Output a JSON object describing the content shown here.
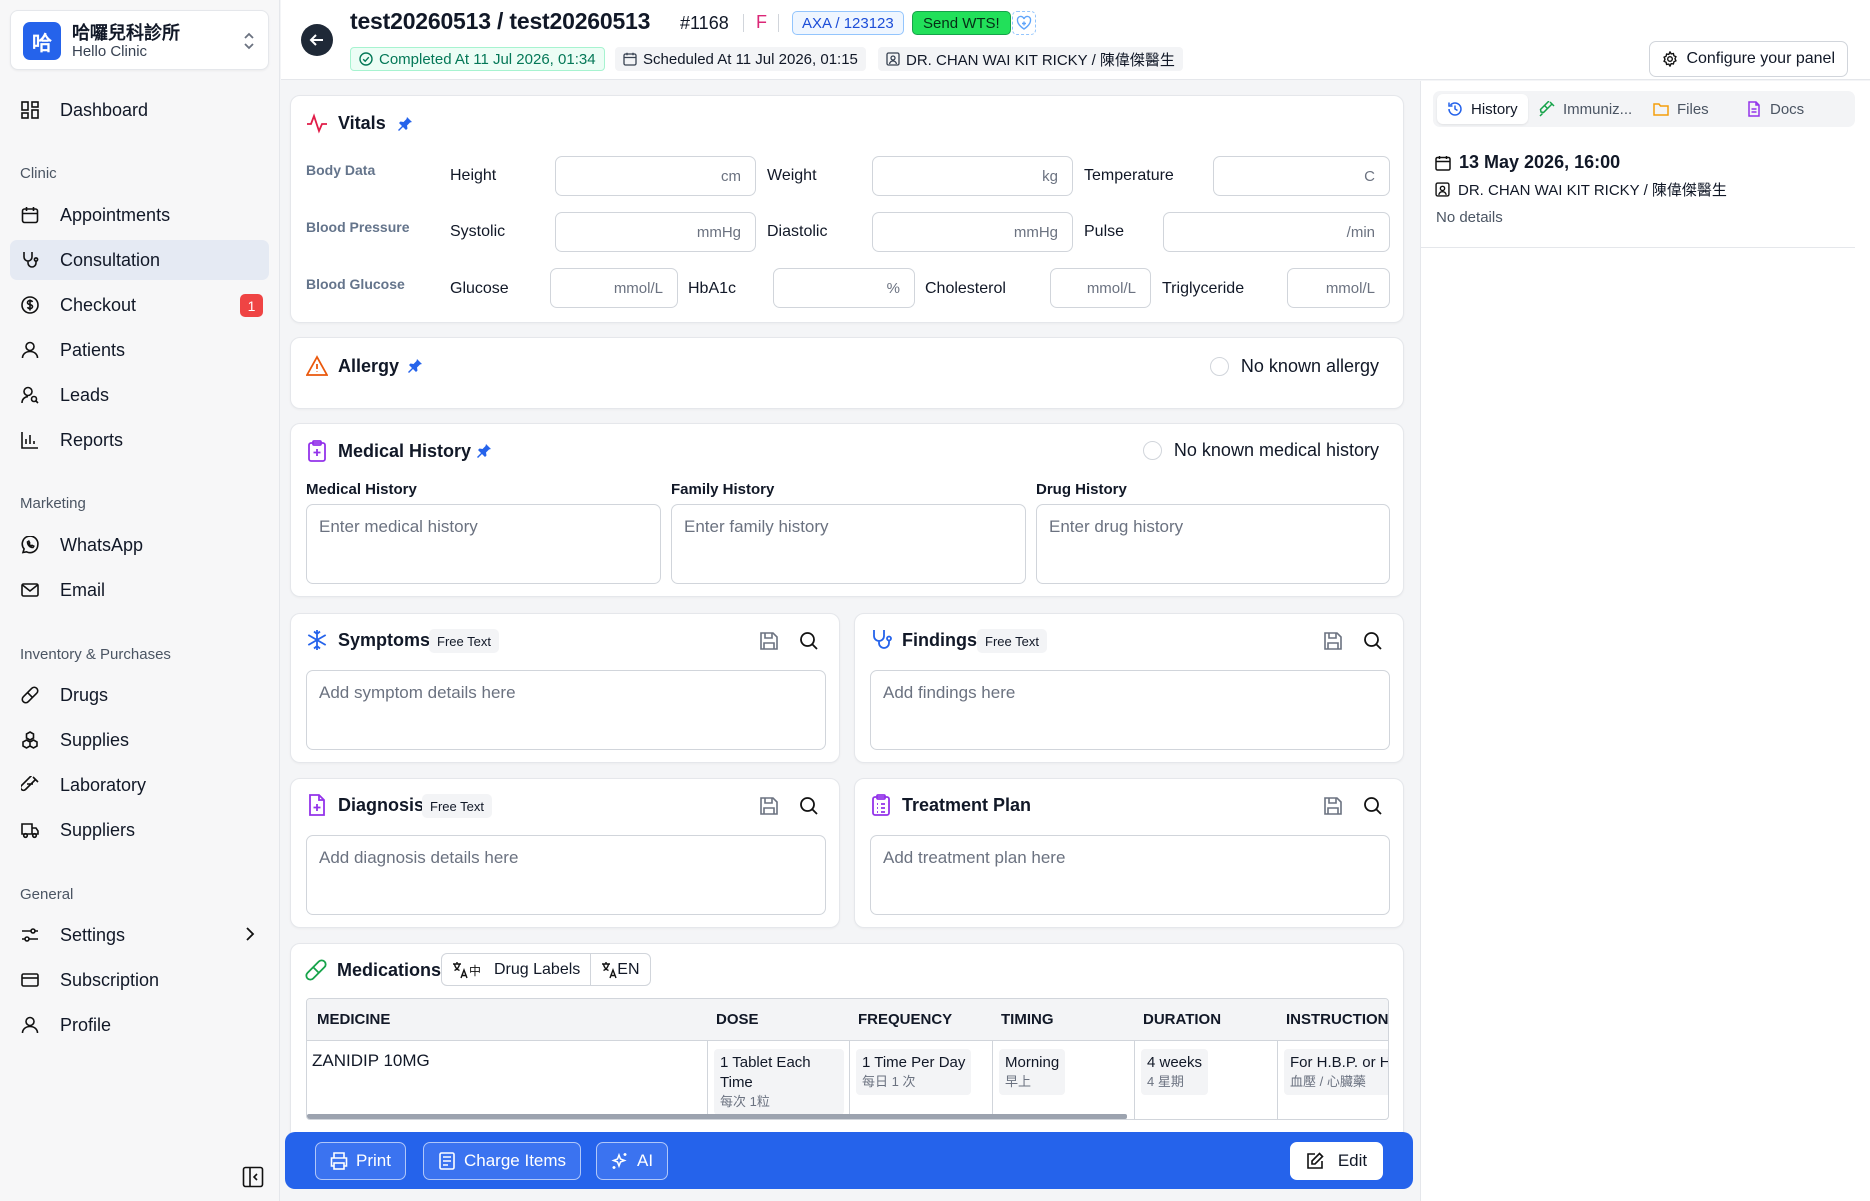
{
  "clinic": {
    "logo_char": "哈",
    "name": "哈囉兒科診所",
    "subtitle": "Hello Clinic"
  },
  "nav": {
    "dashboard": "Dashboard",
    "section_clinic": "Clinic",
    "appointments": "Appointments",
    "consultation": "Consultation",
    "checkout": "Checkout",
    "checkout_badge": "1",
    "patients": "Patients",
    "leads": "Leads",
    "reports": "Reports",
    "section_marketing": "Marketing",
    "whatsapp": "WhatsApp",
    "email": "Email",
    "section_inventory": "Inventory & Purchases",
    "drugs": "Drugs",
    "supplies": "Supplies",
    "laboratory": "Laboratory",
    "suppliers": "Suppliers",
    "section_general": "General",
    "settings": "Settings",
    "subscription": "Subscription",
    "profile": "Profile"
  },
  "header": {
    "patient_title": "test20260513 / test20260513",
    "patient_id": "#1168",
    "sex": "F",
    "insurance": "AXA / 123123",
    "send_wts": "Send WTS!",
    "completed": "Completed At  11 Jul 2026, 01:34",
    "scheduled": "Scheduled At  11 Jul 2026, 01:15",
    "doctor": "DR. CHAN WAI KIT RICKY / 陳偉傑醫生",
    "configure": "Configure your panel"
  },
  "vitals": {
    "title": "Vitals",
    "rows": {
      "body": "Body Data",
      "bp": "Blood Pressure",
      "glucose": "Blood Glucose"
    },
    "fields": {
      "height": {
        "label": "Height",
        "unit": "cm"
      },
      "weight": {
        "label": "Weight",
        "unit": "kg"
      },
      "temperature": {
        "label": "Temperature",
        "unit": "C"
      },
      "systolic": {
        "label": "Systolic",
        "unit": "mmHg"
      },
      "diastolic": {
        "label": "Diastolic",
        "unit": "mmHg"
      },
      "pulse": {
        "label": "Pulse",
        "unit": "/min"
      },
      "glucose": {
        "label": "Glucose",
        "unit": "mmol/L"
      },
      "hba1c": {
        "label": "HbA1c",
        "unit": "%"
      },
      "cholesterol": {
        "label": "Cholesterol",
        "unit": "mmol/L"
      },
      "triglyceride": {
        "label": "Triglyceride",
        "unit": "mmol/L"
      }
    }
  },
  "allergy": {
    "title": "Allergy",
    "none_label": "No known allergy"
  },
  "medical_history": {
    "title": "Medical History",
    "none_label": "No known medical history",
    "medical_label": "Medical History",
    "medical_placeholder": "Enter medical history",
    "family_label": "Family History",
    "family_placeholder": "Enter family history",
    "drug_label": "Drug History",
    "drug_placeholder": "Enter drug history"
  },
  "symptoms": {
    "title": "Symptoms",
    "tag": "Free Text",
    "placeholder": "Add symptom details here"
  },
  "findings": {
    "title": "Findings",
    "tag": "Free Text",
    "placeholder": "Add findings here"
  },
  "diagnosis": {
    "title": "Diagnosis",
    "tag": "Free Text",
    "placeholder": "Add diagnosis details here"
  },
  "treatment": {
    "title": "Treatment Plan",
    "placeholder": "Add treatment plan here"
  },
  "medications": {
    "title": "Medications",
    "drug_labels": "Drug Labels",
    "lang": "EN",
    "columns": [
      "MEDICINE",
      "DOSE",
      "FREQUENCY",
      "TIMING",
      "DURATION",
      "INSTRUCTIONS"
    ],
    "rows": [
      {
        "medicine": "ZANIDIP 10MG",
        "dose": "1 Tablet Each Time",
        "dose_zh": "每次 1粒",
        "frequency": "1 Time Per Day",
        "frequency_zh": "每日 1 次",
        "timing": "Morning",
        "timing_zh": "早上",
        "duration": "4 weeks",
        "duration_zh": "4 星期",
        "instructions": "For H.B.P. or He",
        "instructions_zh": "血壓 / 心臟藥"
      }
    ]
  },
  "actions": {
    "print": "Print",
    "charge_items": "Charge Items",
    "ai": "AI",
    "edit": "Edit"
  },
  "right_panel": {
    "tabs": [
      "History",
      "Immuniz...",
      "Files",
      "Docs"
    ],
    "history_date": "13 May 2026, 16:00",
    "history_doctor": "DR. CHAN WAI KIT RICKY / 陳偉傑醫生",
    "history_details": "No details"
  },
  "colors": {
    "primary": "#2563eb",
    "whatsapp_green": "#22e05a",
    "badge_red": "#ef4444",
    "sex_pink": "#db2777"
  }
}
